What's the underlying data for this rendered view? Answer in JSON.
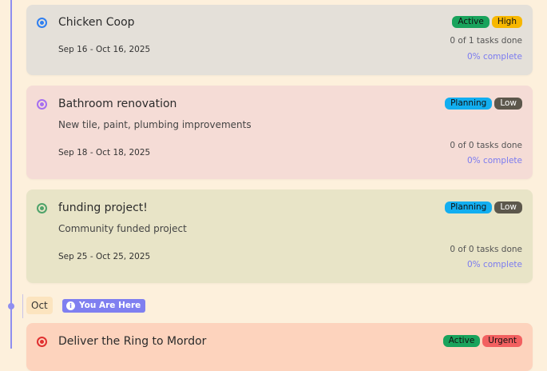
{
  "timeline": {
    "month_label": "Oct",
    "you_are_here": "You Are Here"
  },
  "projects": [
    {
      "title": "Chicken Coop",
      "description": "",
      "dates": "Sep 16 - Oct 16, 2025",
      "status": "Active",
      "priority": "High",
      "tasks": "0 of 1 tasks done",
      "percent": "0% complete",
      "colors": {
        "card": "#e4e0d9",
        "ring": "#2f7ff0",
        "status_bg": "#19a35c",
        "priority_bg": "#f7b700"
      }
    },
    {
      "title": "Bathroom renovation",
      "description": "New tile, paint, plumbing improvements",
      "dates": "Sep 18 - Oct 18, 2025",
      "status": "Planning",
      "priority": "Low",
      "tasks": "0 of 0 tasks done",
      "percent": "0% complete",
      "colors": {
        "card": "#f5dcd6",
        "ring": "#a66ef0",
        "status_bg": "#12aef0",
        "priority_bg": "#5c574c"
      }
    },
    {
      "title": "funding project!",
      "description": "Community funded project",
      "dates": "Sep 25 - Oct 25, 2025",
      "status": "Planning",
      "priority": "Low",
      "tasks": "0 of 0 tasks done",
      "percent": "0% complete",
      "colors": {
        "card": "#e8e4c7",
        "ring": "#4fa36a",
        "status_bg": "#12aef0",
        "priority_bg": "#5c574c"
      }
    },
    {
      "title": "Deliver the Ring to Mordor",
      "description": "",
      "dates": "",
      "status": "Active",
      "priority": "Urgent",
      "tasks": "",
      "percent": "",
      "colors": {
        "card": "#fdd3bd",
        "ring": "#e03030",
        "status_bg": "#19a35c",
        "priority_bg": "#f26060"
      }
    }
  ]
}
